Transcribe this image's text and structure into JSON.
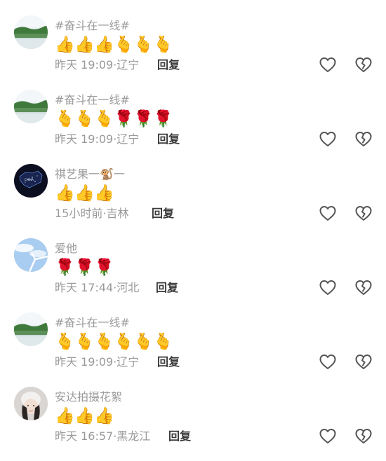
{
  "comments": [
    {
      "name": "#奋斗在一线#",
      "emojis": "👍👍👍🫰🫰🫰",
      "time": "昨天 19:09",
      "location": "辽宁",
      "reply_label": "回复",
      "avatar": "lake"
    },
    {
      "name": "#奋斗在一线#",
      "emojis": "🫰🫰🫰🌹🌹🌹",
      "time": "昨天 19:09",
      "location": "辽宁",
      "reply_label": "回复",
      "avatar": "lake"
    },
    {
      "name": "祺艺果一🐒一",
      "emojis": "👍👍👍",
      "time": "15小时前",
      "location": "吉林",
      "reply_label": "回复",
      "avatar": "map-dark"
    },
    {
      "name": "爱他",
      "emojis": "🌹🌹🌹",
      "time": "昨天 17:44",
      "location": "河北",
      "reply_label": "回复",
      "avatar": "sky"
    },
    {
      "name": "#奋斗在一线#",
      "emojis": "🫰🫰🫰🫰🫰🫰",
      "time": "昨天 19:09",
      "location": "辽宁",
      "reply_label": "回复",
      "avatar": "lake"
    },
    {
      "name": "安达拍摄花絮",
      "emojis": "👍👍👍",
      "time": "昨天 16:57",
      "location": "黑龙江",
      "reply_label": "回复",
      "avatar": "portrait"
    }
  ],
  "icons": {
    "like": "heart-outline-icon",
    "dislike": "broken-heart-outline-icon"
  },
  "colors": {
    "muted_text": "#9a9a9a",
    "reply_text": "#3a3a3a",
    "icon_stroke": "#555555"
  }
}
